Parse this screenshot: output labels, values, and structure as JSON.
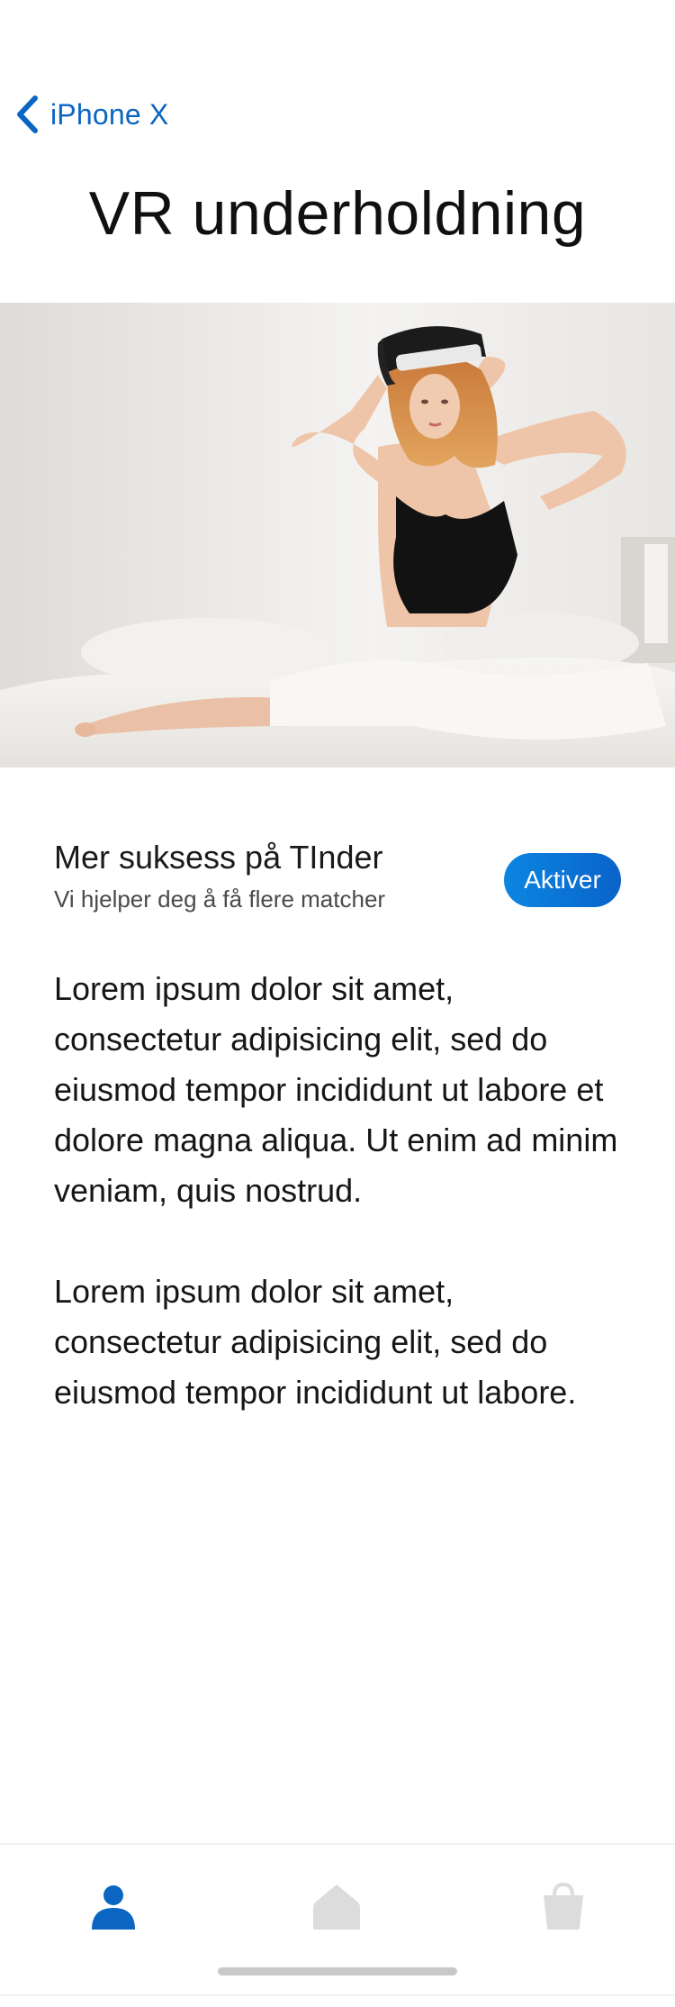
{
  "nav": {
    "back_label": "iPhone X",
    "back_icon": "chevron-left-icon"
  },
  "page": {
    "title": "VR underholdning"
  },
  "hero": {
    "image_name": "vr-headset-photo"
  },
  "offer": {
    "title": "Mer suksess på TInder",
    "subtitle": "Vi hjelper deg å få flere matcher",
    "button_label": "Aktiver"
  },
  "body": {
    "paragraphs": [
      "Lorem ipsum dolor sit amet, consectetur adipisicing elit, sed do eiusmod tempor incididunt ut labore et dolore magna aliqua. Ut enim ad minim veniam, quis nostrud.",
      "Lorem ipsum dolor sit amet, consectetur adipisicing elit, sed do eiusmod tempor incididunt ut labore."
    ]
  },
  "tabbar": {
    "items": [
      {
        "icon": "person-icon",
        "active": true
      },
      {
        "icon": "home-icon",
        "active": false
      },
      {
        "icon": "shopping-bag-icon",
        "active": false
      }
    ]
  },
  "colors": {
    "accent": "#0a66c2",
    "button_start": "#0b86e0",
    "button_end": "#0a63c9",
    "inactive_icon": "#dcdcdc"
  }
}
